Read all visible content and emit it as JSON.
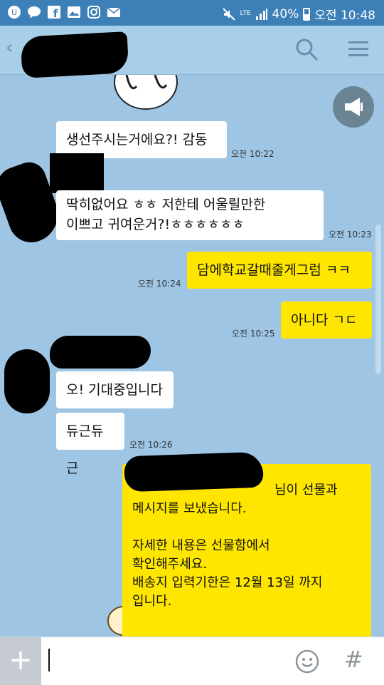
{
  "status_bar": {
    "network": "LTE",
    "battery": "40%",
    "time": "오전 10:48"
  },
  "header": {
    "back_icon": "chevron-left-icon",
    "search_icon": "search-icon",
    "menu_icon": "hamburger-menu-icon"
  },
  "messages": [
    {
      "dir": "in",
      "text": "생선주시는거에요?! 감동",
      "time": "오전 10:22"
    },
    {
      "dir": "in",
      "lines": [
        "딱히없어요 ㅎㅎ 저한테 어울릴만한",
        "이쁘고 귀여운거?!ㅎㅎㅎㅎㅎㅎ"
      ],
      "time": "오전 10:23"
    },
    {
      "dir": "out",
      "text": "담에학교갈때줄게그럼 ㅋㅋ",
      "time": "오전 10:24"
    },
    {
      "dir": "out",
      "text": "아니다 ㄱㄷ",
      "time": "오전 10:25"
    },
    {
      "dir": "in",
      "text": "오! 기대중입니다"
    },
    {
      "dir": "in",
      "text": "듀근듀근",
      "time": "오전 10:26"
    }
  ],
  "gift_message": {
    "line1": "님이 선물과",
    "line2": "메시지를 보냈습니다.",
    "line3": "자세한 내용은 선물함에서",
    "line4": "확인해주세요.",
    "line5": "배송지 입력기한은 12월 13일 까지",
    "line6": "입니다."
  },
  "input_bar": {
    "plus": "+",
    "placeholder": "",
    "hash": "#"
  },
  "colors": {
    "status_bar": "#3d7fb7",
    "chat_bg": "#9ec5e4",
    "outgoing_bubble": "#fee600",
    "incoming_bubble": "#ffffff"
  }
}
